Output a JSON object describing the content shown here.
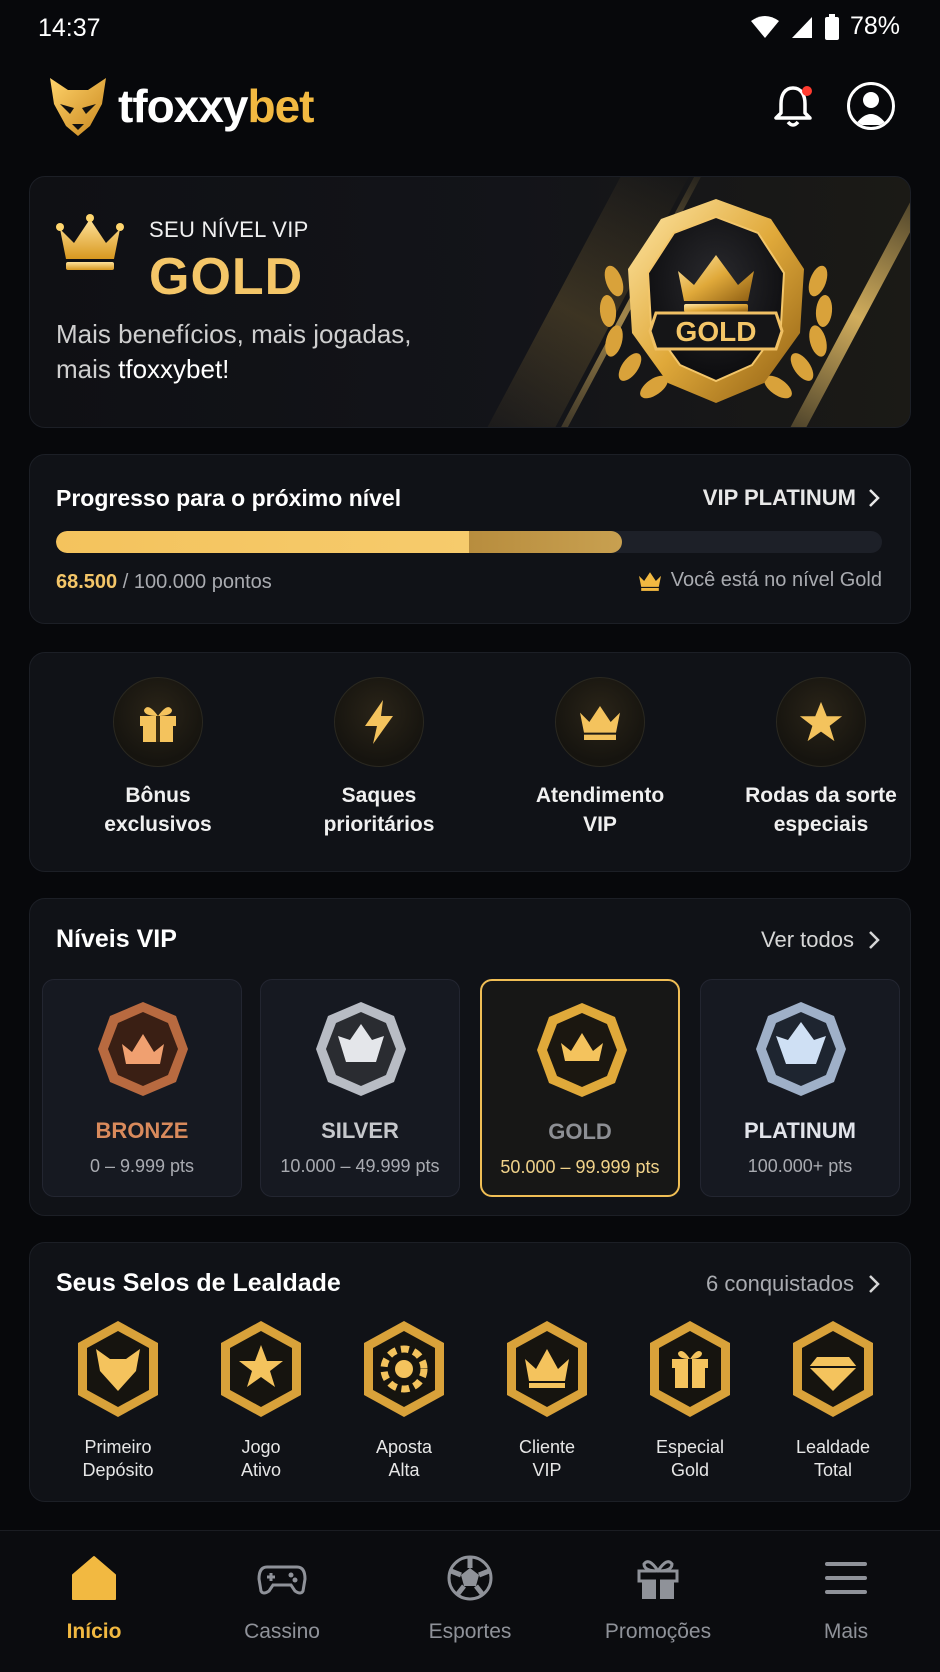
{
  "status": {
    "time": "14:37",
    "battery": "78%"
  },
  "header": {
    "logo_part1": "tfoxxy",
    "logo_part2": "bet"
  },
  "hero": {
    "kicker": "SEU NÍVEL VIP",
    "level": "GOLD",
    "tagline_line1": "Mais benefícios, mais jogadas,",
    "tagline_line2_prefix": "mais ",
    "tagline_line2_brand": "tfoxxybet!",
    "badge_text": "GOLD"
  },
  "progress": {
    "title": "Progresso para o próximo nível",
    "next_level": "VIP PLATINUM",
    "current_points": "68.500",
    "total_points": " / 100.000 pontos",
    "fill_fraction": 0.685,
    "fill_bright_fraction": 0.5,
    "current_level_text": "Você está no nível Gold"
  },
  "benefits": [
    {
      "line1": "Bônus",
      "line2": "exclusivos",
      "icon": "gift-icon"
    },
    {
      "line1": "Saques",
      "line2": "prioritários",
      "icon": "lightning-icon"
    },
    {
      "line1": "Atendimento",
      "line2": "VIP",
      "icon": "crown-icon"
    },
    {
      "line1": "Rodas da sorte",
      "line2": "especiais",
      "icon": "star-icon"
    }
  ],
  "levels": {
    "title": "Níveis VIP",
    "see_all": "Ver todos",
    "items": [
      {
        "name": "BRONZE",
        "range": "0 – 9.999 pts",
        "color": "#d98a5c"
      },
      {
        "name": "SILVER",
        "range": "10.000 – 49.999 pts",
        "color": "#c6c8cc"
      },
      {
        "name": "GOLD",
        "range": "50.000 – 99.999 pts",
        "color": "#8d8f94"
      },
      {
        "name": "PLATINUM",
        "range": "100.000+ pts",
        "color": "#e2e4ea"
      }
    ]
  },
  "loyalty": {
    "title": "Seus Selos de Lealdade",
    "count": "6 conquistados",
    "seals": [
      {
        "line1": "Primeiro",
        "line2": "Depósito",
        "icon": "fox-icon"
      },
      {
        "line1": "Jogo",
        "line2": "Ativo",
        "icon": "star-icon"
      },
      {
        "line1": "Aposta",
        "line2": "Alta",
        "icon": "chip-icon"
      },
      {
        "line1": "Cliente",
        "line2": "VIP",
        "icon": "crown-icon"
      },
      {
        "line1": "Especial",
        "line2": "Gold",
        "icon": "gift-icon"
      },
      {
        "line1": "Lealdade",
        "line2": "Total",
        "icon": "diamond-icon"
      }
    ]
  },
  "nav": [
    {
      "label": "Início",
      "icon": "home-icon",
      "active": true
    },
    {
      "label": "Cassino",
      "icon": "gamepad-icon",
      "active": false
    },
    {
      "label": "Esportes",
      "icon": "ball-icon",
      "active": false
    },
    {
      "label": "Promoções",
      "icon": "gift-icon",
      "active": false
    },
    {
      "label": "Mais",
      "icon": "menu-icon",
      "active": false
    }
  ],
  "colors": {
    "gold": "#f2b941",
    "background": "#07080b",
    "card": "#101217"
  }
}
